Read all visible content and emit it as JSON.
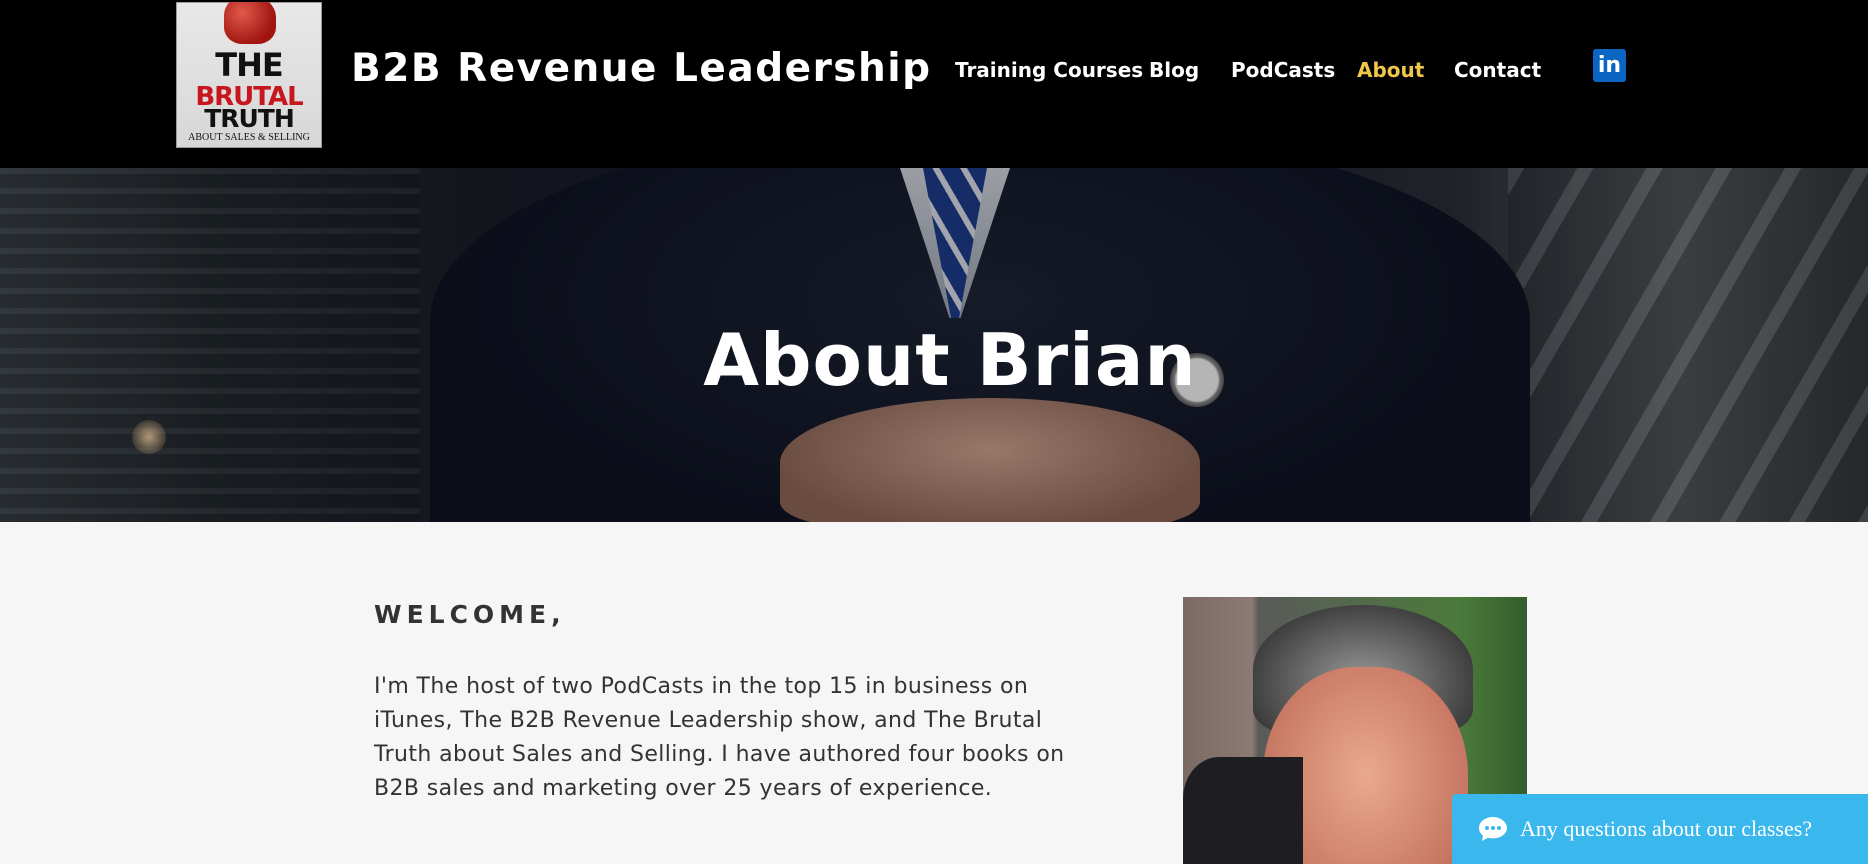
{
  "header": {
    "logo": {
      "line1": "THE",
      "line2": "BRUTAL",
      "line3": "TRUTH",
      "line4": "ABOUT SALES & SELLING"
    },
    "site_title": "B2B Revenue Leadership",
    "nav": [
      {
        "label": "Training Courses",
        "active": false
      },
      {
        "label": "Blog",
        "active": false
      },
      {
        "label": "PodCasts",
        "active": false
      },
      {
        "label": "About",
        "active": true
      },
      {
        "label": "Contact",
        "active": false
      }
    ],
    "social": {
      "icon": "linkedin-icon",
      "label": "in"
    },
    "active_color": "#f0c64b"
  },
  "hero": {
    "title": "About Brian"
  },
  "content": {
    "heading": "WELCOME,",
    "bio": "I'm The host of two PodCasts in the top 15 in business on iTunes, The B2B Revenue Leadership show, and The Brutal Truth about Sales and Selling. I have authored four books on B2B sales and marketing over 25 years of experience."
  },
  "chat": {
    "label": "Any questions about our classes?",
    "icon": "chat-bubble-icon",
    "color": "#3ab7ed"
  }
}
